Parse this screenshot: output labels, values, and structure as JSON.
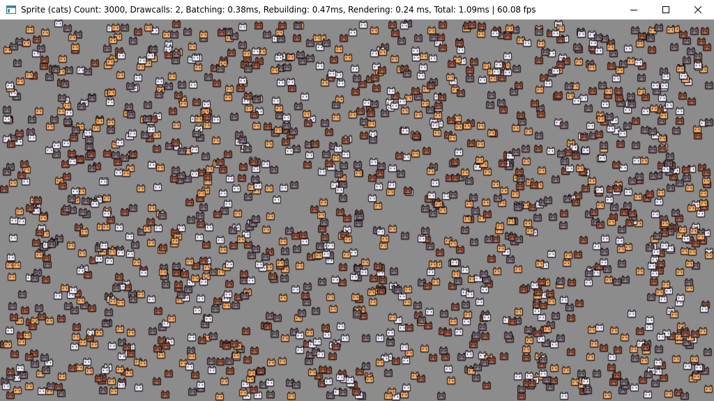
{
  "window": {
    "title": "Sprite (cats) Count: 3000, Drawcalls: 2, Batching: 0.38ms, Rebuilding: 0.47ms, Rendering: 0.24 ms, Total: 1.09ms | 60.08 fps",
    "icon": "app-window-icon",
    "controls": {
      "minimize_icon": "minimize-icon",
      "maximize_icon": "maximize-icon",
      "close_icon": "close-icon"
    }
  },
  "scene": {
    "background_color": "#8c8c8c",
    "sprite_count": 3000,
    "sprite_colors": [
      "#e9a15c",
      "#8a4a34",
      "#6e6068",
      "#e8e6f4"
    ],
    "sprite_outline": "#1d1416"
  }
}
